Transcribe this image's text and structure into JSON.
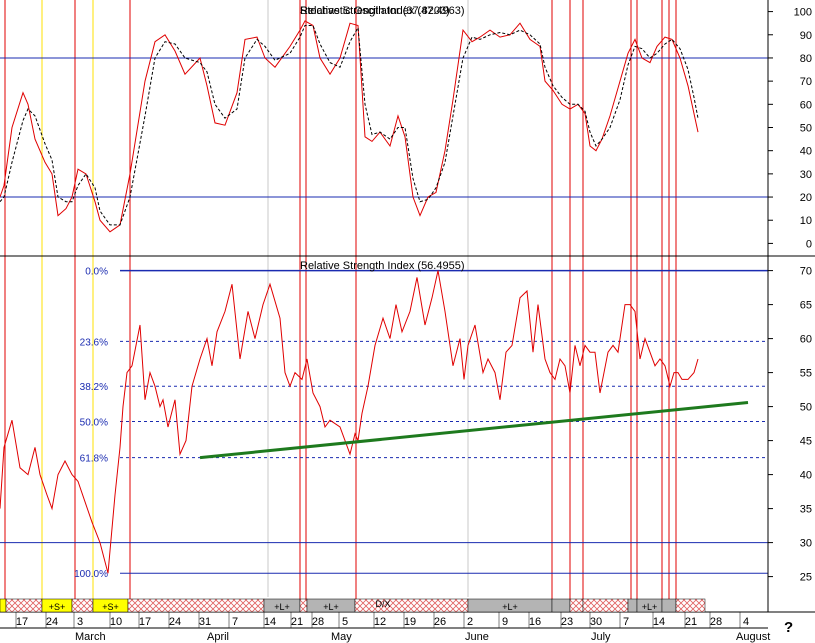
{
  "chart_data": [
    {
      "type": "line",
      "title": "Stochastic Oscillator (37.8203)",
      "overlay_title": "Relative Strength Index (47.4963)",
      "ylim": [
        -5,
        105
      ],
      "yticks": [
        0,
        10,
        20,
        30,
        40,
        50,
        60,
        70,
        80,
        90,
        100
      ],
      "hlines": [
        20,
        80
      ],
      "series": [
        {
          "color": "#e00000",
          "style": "solid",
          "x": [
            0,
            4,
            12,
            23,
            28,
            35,
            45,
            52,
            58,
            66,
            72,
            78,
            86,
            95,
            100,
            110,
            120,
            130,
            145,
            155,
            165,
            175,
            185,
            200,
            207,
            215,
            225,
            237,
            245,
            257,
            265,
            275,
            290,
            300,
            305,
            313,
            320,
            330,
            340,
            350,
            358,
            365,
            372,
            380,
            390,
            398,
            405,
            413,
            420,
            428,
            436,
            445,
            453,
            463,
            472,
            480,
            490,
            500,
            510,
            520,
            530,
            540,
            545,
            553,
            562,
            570,
            578,
            585,
            590,
            596,
            602,
            610,
            620,
            628,
            635,
            642,
            650,
            657,
            665,
            672,
            680,
            688,
            694,
            698
          ],
          "y": [
            20,
            25,
            50,
            65,
            60,
            45,
            35,
            30,
            12,
            15,
            20,
            32,
            30,
            18,
            10,
            5,
            8,
            30,
            70,
            87,
            90,
            83,
            73,
            80,
            68,
            52,
            51,
            65,
            88,
            89,
            80,
            76,
            85,
            92,
            96,
            94,
            80,
            73,
            80,
            95,
            94,
            46,
            44,
            48,
            42,
            55,
            46,
            20,
            12,
            20,
            22,
            40,
            62,
            92,
            87,
            89,
            92,
            89,
            90,
            95,
            88,
            85,
            70,
            66,
            60,
            58,
            60,
            56,
            42,
            40,
            45,
            55,
            70,
            82,
            88,
            80,
            78,
            85,
            89,
            88,
            80,
            68,
            56,
            48
          ]
        },
        {
          "color": "#000000",
          "style": "dashed",
          "x": [
            0,
            4,
            12,
            23,
            28,
            35,
            45,
            52,
            58,
            66,
            72,
            78,
            86,
            95,
            100,
            110,
            120,
            130,
            145,
            155,
            165,
            175,
            185,
            200,
            207,
            215,
            225,
            237,
            245,
            257,
            265,
            275,
            290,
            300,
            305,
            313,
            320,
            330,
            340,
            350,
            358,
            365,
            372,
            380,
            390,
            398,
            405,
            413,
            420,
            428,
            436,
            445,
            453,
            463,
            472,
            480,
            490,
            500,
            510,
            520,
            530,
            540,
            545,
            553,
            562,
            570,
            578,
            585,
            590,
            596,
            602,
            610,
            620,
            628,
            635,
            642,
            650,
            657,
            665,
            672,
            680,
            688,
            694,
            698
          ],
          "y": [
            18,
            20,
            35,
            53,
            58,
            55,
            43,
            36,
            20,
            18,
            18,
            25,
            30,
            24,
            14,
            8,
            8,
            20,
            55,
            80,
            87,
            86,
            80,
            78,
            74,
            60,
            54,
            58,
            80,
            88,
            85,
            79,
            82,
            89,
            94,
            94,
            86,
            78,
            76,
            87,
            93,
            60,
            47,
            48,
            45,
            50,
            50,
            28,
            18,
            19,
            24,
            35,
            55,
            80,
            89,
            88,
            90,
            91,
            90,
            92,
            90,
            86,
            76,
            68,
            63,
            60,
            60,
            57,
            48,
            42,
            45,
            50,
            62,
            77,
            85,
            84,
            80,
            82,
            86,
            88,
            84,
            75,
            63,
            54
          ]
        }
      ]
    },
    {
      "type": "line",
      "title": "Relative Strength Index (56.4955)",
      "ylim": [
        22,
        72
      ],
      "yticks": [
        25,
        30,
        35,
        40,
        45,
        50,
        55,
        60,
        65,
        70
      ],
      "hlines": [
        30,
        70
      ],
      "fib_levels": [
        {
          "label": "0.0%",
          "value": 70.0
        },
        {
          "label": "23.6%",
          "value": 59.6
        },
        {
          "label": "38.2%",
          "value": 53.0
        },
        {
          "label": "50.0%",
          "value": 47.8
        },
        {
          "label": "61.8%",
          "value": 42.5
        },
        {
          "label": "100.0%",
          "value": 25.5
        }
      ],
      "trendline": {
        "color": "#1e7a1e",
        "x": [
          200,
          748
        ],
        "y": [
          42.5,
          50.6
        ]
      },
      "series": [
        {
          "color": "#e00000",
          "style": "solid",
          "x": [
            0,
            4,
            12,
            20,
            28,
            35,
            40,
            47,
            52,
            58,
            65,
            72,
            78,
            85,
            92,
            100,
            108,
            115,
            120,
            123,
            127,
            132,
            140,
            145,
            150,
            155,
            160,
            163,
            168,
            175,
            180,
            186,
            192,
            200,
            207,
            212,
            217,
            225,
            232,
            240,
            248,
            255,
            263,
            270,
            280,
            285,
            290,
            295,
            302,
            307,
            313,
            320,
            325,
            330,
            340,
            345,
            350,
            355,
            358,
            362,
            368,
            375,
            383,
            390,
            396,
            402,
            410,
            417,
            425,
            432,
            438,
            445,
            453,
            460,
            464,
            468,
            475,
            483,
            488,
            495,
            500,
            506,
            512,
            520,
            527,
            533,
            538,
            545,
            550,
            555,
            560,
            565,
            570,
            575,
            580,
            585,
            590,
            595,
            600,
            608,
            613,
            618,
            625,
            630,
            635,
            640,
            645,
            650,
            655,
            660,
            665,
            670,
            674,
            678,
            682,
            688,
            694,
            698
          ],
          "y": [
            35,
            44,
            48,
            41,
            40,
            44,
            40,
            37,
            35,
            40,
            42,
            40,
            39,
            36,
            33,
            30,
            25.5,
            37,
            44,
            50,
            55,
            56,
            62,
            51,
            55,
            53,
            50,
            51,
            47,
            51,
            43,
            45,
            53,
            57,
            60,
            56,
            61,
            64,
            68,
            57,
            64,
            60,
            65,
            68,
            63,
            55,
            53,
            55,
            54,
            57,
            52,
            50,
            47,
            48,
            47,
            45,
            43,
            46,
            45,
            49,
            53,
            59,
            63,
            60,
            65,
            61,
            64,
            69,
            62,
            66,
            70,
            64,
            56,
            60,
            54,
            59,
            62,
            55,
            57,
            55,
            51,
            58,
            59,
            66,
            67,
            58,
            65,
            57,
            55,
            54,
            57,
            56,
            52,
            59,
            56,
            59,
            58,
            58,
            52,
            58,
            59,
            58,
            65,
            65,
            64,
            57,
            60,
            58,
            56,
            57,
            56,
            53,
            55,
            55,
            54,
            54,
            55,
            57
          ]
        }
      ]
    }
  ],
  "y_axis_top_labels": [
    "100",
    "90",
    "80",
    "70",
    "60",
    "50",
    "40",
    "30",
    "20",
    "10",
    "0"
  ],
  "y_axis_bottom_labels": [
    "70",
    "65",
    "60",
    "55",
    "50",
    "45",
    "40",
    "35",
    "30",
    "25"
  ],
  "date_labels": [
    "17",
    "24",
    "3",
    "10",
    "17",
    "24",
    "31",
    "7",
    "14",
    "21",
    "28",
    "5",
    "12",
    "19",
    "26",
    "2",
    "9",
    "16",
    "23",
    "30",
    "7",
    "14",
    "21",
    "28",
    "4"
  ],
  "month_labels": [
    "March",
    "April",
    "May",
    "June",
    "July",
    "August"
  ],
  "band_labels": [
    "+S+",
    "+S+",
    "+L+",
    "+L+",
    "D/X",
    "+L+",
    "+L+"
  ],
  "question_mark": "?",
  "colors": {
    "vline_red": "#e00000",
    "vline_yellow": "#ffe000",
    "hline_blue": "#1a2bb0",
    "fib_blue": "#1a2bb0",
    "grid_gray": "#c8c8c8",
    "band_red": "#e06060",
    "band_gray": "#b4b4b4",
    "band_yellow": "#ffff00"
  }
}
